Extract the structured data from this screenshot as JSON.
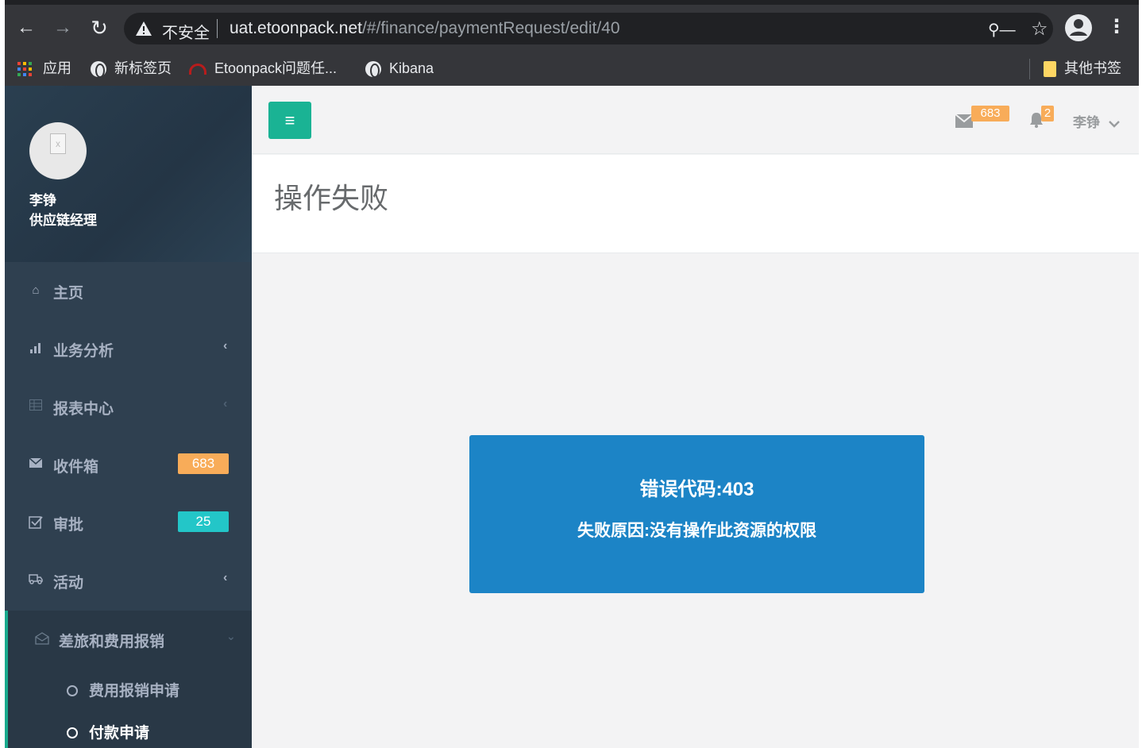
{
  "browser": {
    "insecure_label": "不安全",
    "url_host": "uat.etoonpack.net",
    "url_path": "/#/finance/paymentRequest/edit/40",
    "bookmarks": [
      {
        "label": "应用",
        "icon": "apps-grid-icon"
      },
      {
        "label": "新标签页",
        "icon": "globe-icon"
      },
      {
        "label": "Etoonpack问题任...",
        "icon": "etoonpack-icon"
      },
      {
        "label": "Kibana",
        "icon": "globe-icon"
      }
    ],
    "other_bookmarks": "其他书签"
  },
  "profile": {
    "name": "李铮",
    "role": "供应链经理"
  },
  "sidebar": {
    "items": [
      {
        "label": "主页",
        "icon": "home-icon"
      },
      {
        "label": "业务分析",
        "icon": "bar-chart-icon"
      },
      {
        "label": "报表中心",
        "icon": "table-icon"
      },
      {
        "label": "收件箱",
        "icon": "envelope-icon",
        "badge": "683"
      },
      {
        "label": "审批",
        "icon": "check-square-icon",
        "badge": "25"
      },
      {
        "label": "活动",
        "icon": "truck-icon"
      },
      {
        "label": "差旅和费用报销",
        "icon": "envelope-open-icon"
      }
    ],
    "subitems": [
      {
        "label": "费用报销申请"
      },
      {
        "label": "付款申请"
      }
    ]
  },
  "topbar": {
    "mail_count": "683",
    "notification_count": "2",
    "user": "李铮"
  },
  "page": {
    "title": "操作失败"
  },
  "error": {
    "code_text": "错误代码:403",
    "reason_text": "失败原因:没有操作此资源的权限"
  },
  "colors": {
    "sidebar_bg": "#2f4050",
    "primary": "#1ab394",
    "error_box": "#1c84c6",
    "badge_orange": "#f8ac59",
    "badge_teal": "#23c6c8"
  }
}
